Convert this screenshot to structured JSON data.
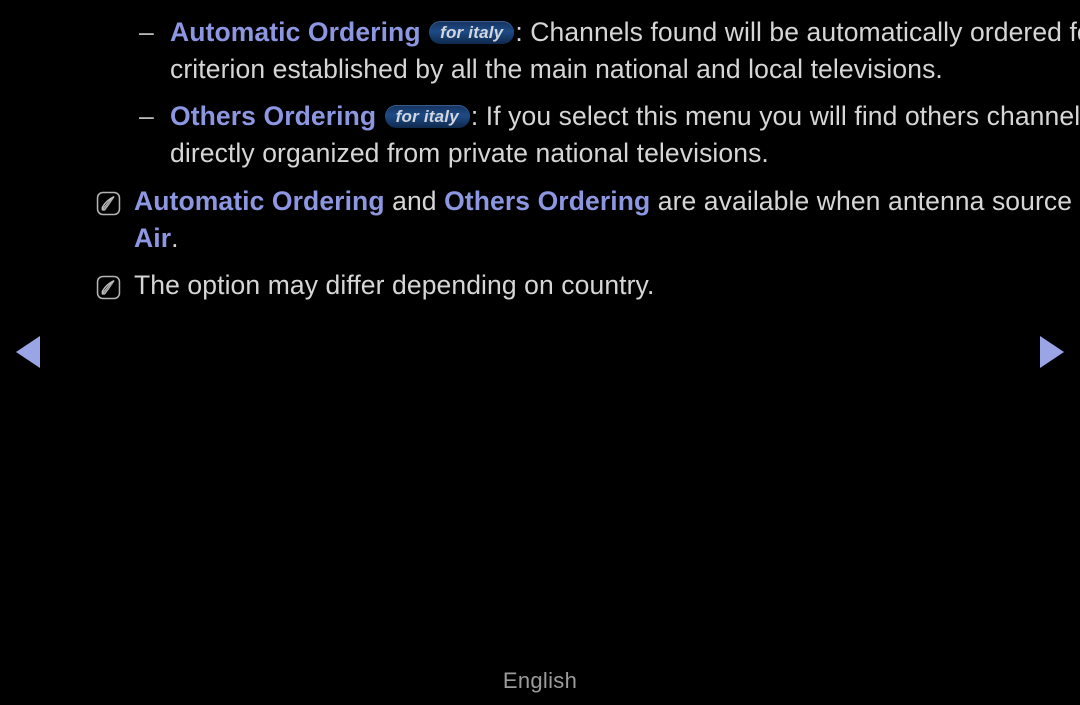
{
  "page": {
    "background_color": "#000000",
    "accent_color": "#8d96e0",
    "body_text_color": "#d6d6d6",
    "badge_color": "#1d4b86",
    "arrow_color": "#9aa5e6"
  },
  "bullets": [
    {
      "marker": "–",
      "term": "Automatic Ordering",
      "badge": "for italy",
      "separator": ":",
      "text": " Channels found will be automatically ordered following a criterion established by all the main national and local televisions."
    },
    {
      "marker": "–",
      "term": "Others Ordering",
      "badge": "for italy",
      "separator": ":",
      "text": " If you select this menu you will find others channels ordering directly organized from private national televisions."
    }
  ],
  "notes": [
    {
      "icon": "note-pen-icon",
      "segments": [
        {
          "text": "Automatic Ordering",
          "accent": true
        },
        {
          "text": " and ",
          "accent": false
        },
        {
          "text": "Others Ordering",
          "accent": true
        },
        {
          "text": " are available when antenna source is set to ",
          "accent": false
        },
        {
          "text": "Air",
          "accent": true
        },
        {
          "text": ".",
          "accent": false
        }
      ]
    },
    {
      "icon": "note-pen-icon",
      "segments": [
        {
          "text": "The option may differ depending on country.",
          "accent": false
        }
      ]
    }
  ],
  "navigation": {
    "prev_label": "◀",
    "next_label": "▶",
    "prev_name": "previous-page-arrow",
    "next_name": "next-page-arrow"
  },
  "footer": {
    "language": "English"
  }
}
